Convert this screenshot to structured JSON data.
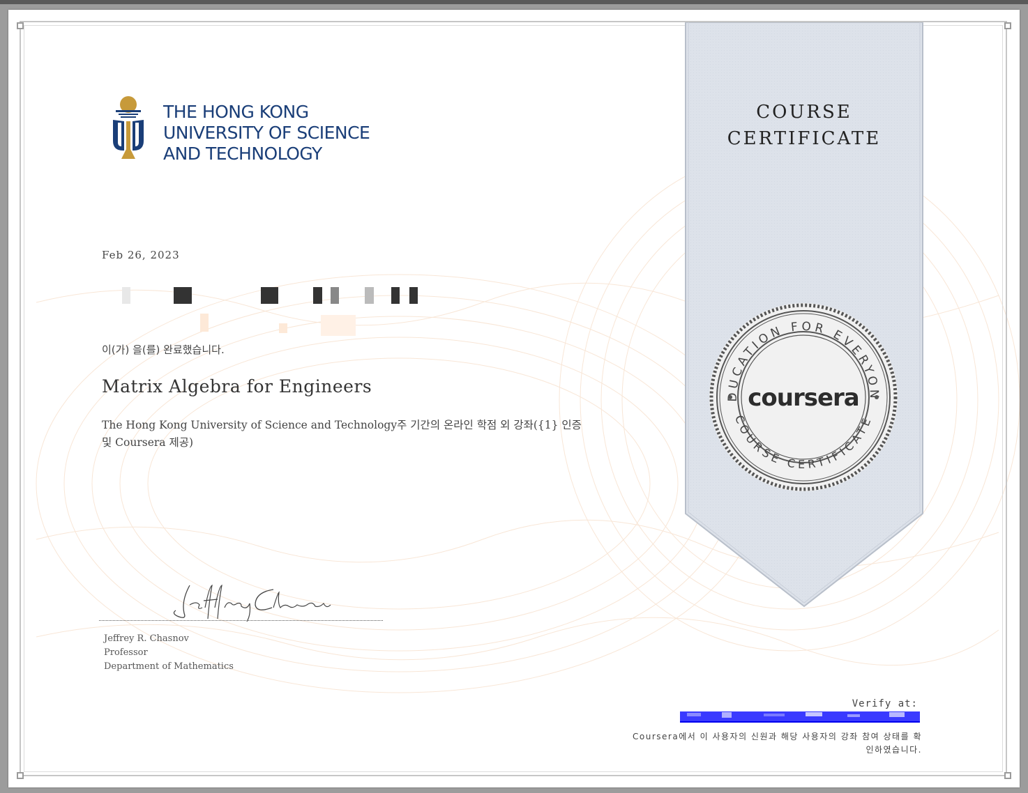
{
  "institution": {
    "line1": "THE HONG KONG",
    "line2": "UNIVERSITY OF SCIENCE",
    "line3": "AND TECHNOLOGY",
    "color": "#1a3e78",
    "accent_gold": "#c79a3a"
  },
  "certificate": {
    "date": "Feb 26, 2023",
    "completed_text": "이(가) 을(를) 완료했습니다.",
    "course_title": "Matrix Algebra for Engineers",
    "description": "The Hong Kong University of Science and Technology주 기간의 온라인 학점 외 강좌({1} 인증 및 Coursera 제공)"
  },
  "signer": {
    "name": "Jeffrey R. Chasnov",
    "title": "Professor",
    "department": "Department of Mathematics"
  },
  "ribbon": {
    "line1": "COURSE",
    "line2": "CERTIFICATE",
    "color": "#dde2ea"
  },
  "seal": {
    "brand": "coursera",
    "top_text": "EDUCATION FOR EVERYONE",
    "bottom_text": "COURSE CERTIFICATE"
  },
  "verify": {
    "label": "Verify at:",
    "note_line1": "Coursera에서 이 사용자의 신원과 해당 사용자의 강좌 참여 상태를 확",
    "note_line2": "인하였습니다."
  }
}
